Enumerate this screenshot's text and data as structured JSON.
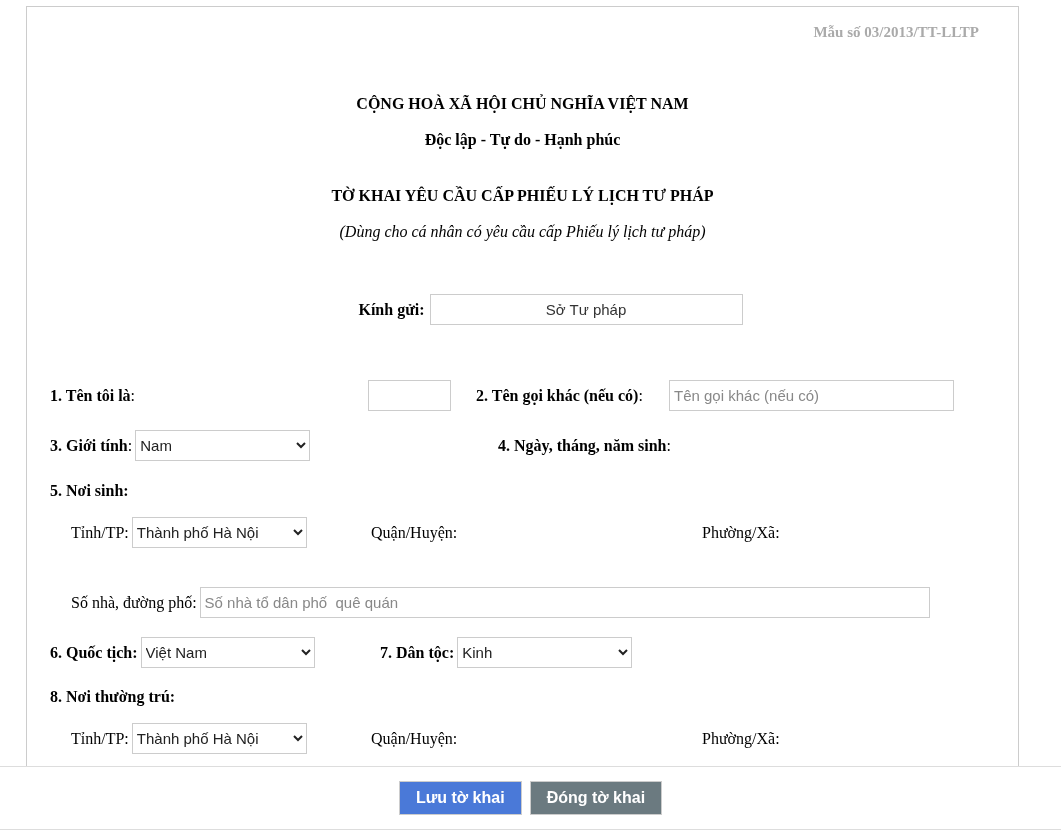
{
  "form_number": "Mẫu số 03/2013/TT-LLTP",
  "header": {
    "nation": "CỘNG HOÀ XÃ HỘI CHỦ NGHĨA VIỆT NAM",
    "motto": "Độc lập - Tự do - Hạnh phúc",
    "title": "TỜ KHAI YÊU CẦU CẤP PHIẾU LÝ LỊCH TƯ PHÁP",
    "subtitle": "(Dùng cho cá nhân có yêu cầu cấp Phiếu lý lịch tư pháp)"
  },
  "recipient": {
    "label": "Kính gửi:",
    "value": "Sở Tư pháp"
  },
  "name_row": {
    "name": {
      "label": "**1. Tên tôi là**:"
    },
    "alias": {
      "label": "**2. Tên gọi khác (nếu có)**:",
      "placeholder": "Tên gọi khác (nếu có)"
    }
  },
  "gender_row": {
    "gender": {
      "label": "**3. Giới tính**:",
      "value": "Nam"
    },
    "birth_date": {
      "label": "**4. Ngày, tháng, năm sinh**:"
    }
  },
  "birthplace": {
    "label": "5. Nơi sinh:",
    "province": {
      "label": "Tỉnh/TP:",
      "value": "Thành phố Hà Nội"
    },
    "district": {
      "label": "Quận/Huyện:"
    },
    "ward": {
      "label": "Phường/Xã:"
    },
    "street": {
      "label": "Số nhà, đường phố:",
      "placeholder": "Số nhà tổ dân phố  quê quán"
    }
  },
  "nationality_row": {
    "nationality": {
      "label": "6. Quốc tịch:",
      "value": "Việt Nam"
    },
    "ethnicity": {
      "label": "7. Dân tộc:",
      "value": "Kinh"
    }
  },
  "residence": {
    "label": "8. Nơi thường trú:",
    "province": {
      "label": "Tỉnh/TP:",
      "value": "Thành phố Hà Nội"
    },
    "district": {
      "label": "Quận/Huyện:"
    },
    "ward": {
      "label": "Phường/Xã:"
    }
  },
  "buttons": [
    {
      "label": "Lưu tờ khai",
      "kind": "primary"
    },
    {
      "label": "Đóng tờ khai",
      "kind": "secondary"
    }
  ]
}
